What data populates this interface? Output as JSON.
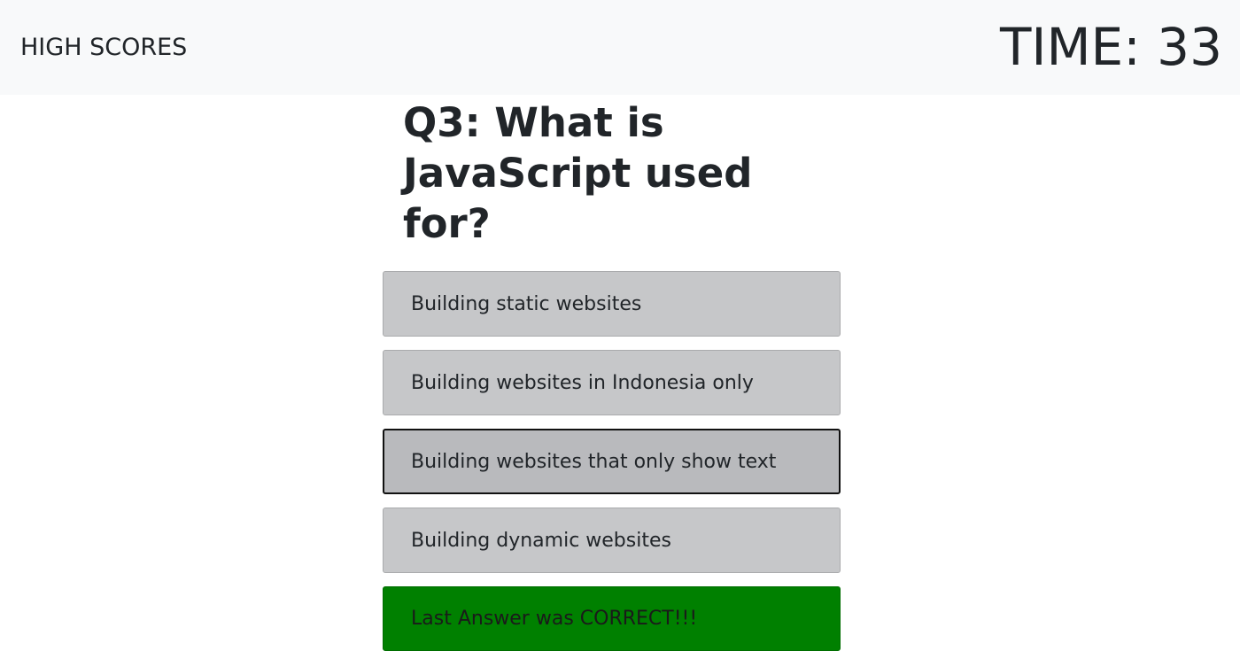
{
  "navbar": {
    "high_scores_label": "HIGH SCORES",
    "timer_text": "TIME: 33"
  },
  "quiz": {
    "question": "Q3: What is JavaScript used for?",
    "answers": [
      {
        "label": "Building static websites"
      },
      {
        "label": "Building websites in Indonesia only"
      },
      {
        "label": "Building websites that only show text"
      },
      {
        "label": "Building dynamic websites"
      }
    ],
    "feedback": "Last Answer was CORRECT!!!"
  },
  "colors": {
    "navbar_bg": "#f8f9fa",
    "answer_bg": "#c6c7c9",
    "feedback_bg": "#008000",
    "text": "#212529"
  }
}
